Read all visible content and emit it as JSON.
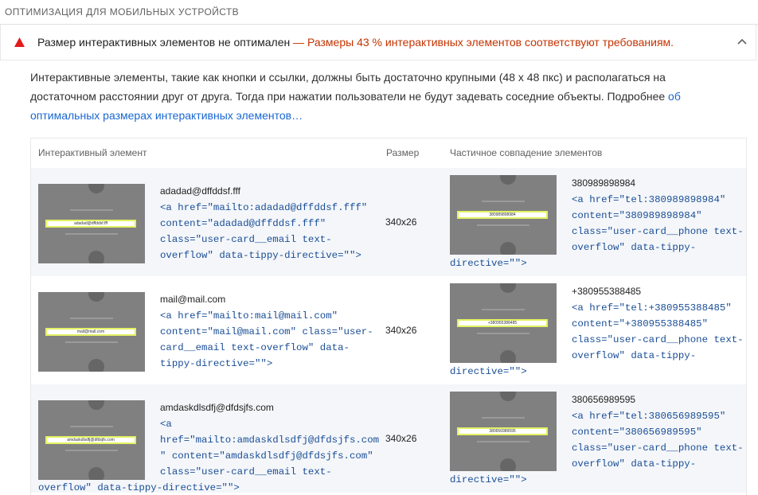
{
  "section_title": "ОПТИМИЗАЦИЯ ДЛЯ МОБИЛЬНЫХ УСТРОЙСТВ",
  "colors": {
    "warning": "#c33300",
    "link": "#1967d2",
    "code": "#1a4e96"
  },
  "audit": {
    "status_icon": "warning-triangle-icon",
    "title": "Размер интерактивных элементов не оптимален",
    "dash": "—",
    "result": "Размеры 43 % интерактивных элементов соответствуют требованиям.",
    "toggle_icon": "chevron-up-icon"
  },
  "description": {
    "text": "Интерактивные элементы, такие как кнопки и ссылки, должны быть достаточно крупными (48 x 48 пкс) и располагаться на достаточном расстоянии друг от друга. Тогда при нажатии пользователи не будут задевать соседние объекты. Подробнее ",
    "link_text": "об оптимальных размерах интерактивных элементов…"
  },
  "table": {
    "headers": [
      "Интерактивный элемент",
      "Размер",
      "Частичное совпадение элементов"
    ],
    "rows": [
      {
        "target": {
          "text": "adadad@dffddsf.fff",
          "snippet_lines": [
            "<a href=\"mailto:adadad@dffddsf.fff\"",
            "content=\"adadad@dffddsf.fff\"",
            "class=\"user-card__email text-",
            "overflow\" data-tippy-directive=\"\">"
          ],
          "thumb_text": "adadad@dffddsf.fff"
        },
        "size": "340x26",
        "overlap": {
          "text": "380989898984",
          "snippet_lines": [
            "<a href=\"tel:380989898984\"",
            "content=\"380989898984\"",
            "class=\"user-card__phone text-",
            "overflow\" data-tippy-"
          ],
          "snippet_tail": "directive=\"\">",
          "thumb_text": "380989898984"
        }
      },
      {
        "target": {
          "text": "mail@mail.com",
          "snippet_lines": [
            "<a href=\"mailto:mail@mail.com\"",
            "content=\"mail@mail.com\" class=\"user-",
            "card__email text-overflow\" data-",
            "tippy-directive=\"\">"
          ],
          "thumb_text": "mail@mail.com"
        },
        "size": "340x26",
        "overlap": {
          "text": "+380955388485",
          "snippet_lines": [
            "<a href=\"tel:+380955388485\"",
            "content=\"+380955388485\"",
            "class=\"user-card__phone text-",
            "overflow\" data-tippy-"
          ],
          "snippet_tail": "directive=\"\">",
          "thumb_text": "+380955388485"
        }
      },
      {
        "target": {
          "text": "amdaskdlsdfj@dfdsjfs.com",
          "snippet_lines": [
            "<a",
            "href=\"mailto:amdaskdlsdfj@dfdsjfs.com",
            "\" content=\"amdaskdlsdfj@dfdsjfs.com\"",
            "class=\"user-card__email text-"
          ],
          "snippet_tail": "overflow\" data-tippy-directive=\"\">",
          "thumb_text": "amdaskdlsdfj@dfdsjfs.com"
        },
        "size": "340x26",
        "overlap": {
          "text": "380656989595",
          "snippet_lines": [
            "<a href=\"tel:380656989595\"",
            "content=\"380656989595\"",
            "class=\"user-card__phone text-",
            "overflow\" data-tippy-"
          ],
          "snippet_tail": "directive=\"\">",
          "thumb_text": "380656989595"
        }
      }
    ]
  }
}
